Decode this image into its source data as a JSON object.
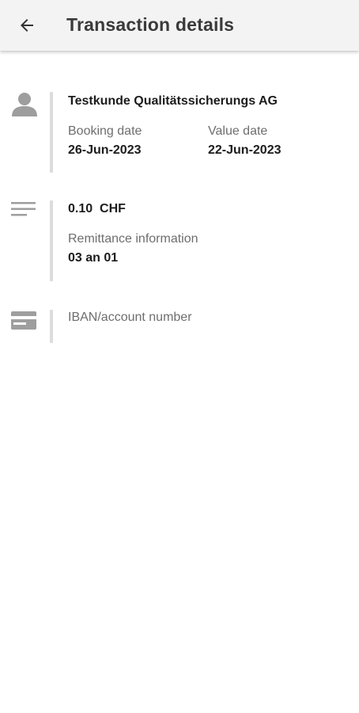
{
  "header": {
    "title": "Transaction details",
    "back_icon": "arrow-left-icon"
  },
  "counterparty": {
    "icon": "person-icon",
    "name": "Testkunde Qualitätssicherungs AG",
    "booking_date_label": "Booking date",
    "booking_date": "26-Jun-2023",
    "value_date_label": "Value date",
    "value_date": "22-Jun-2023"
  },
  "amount": {
    "icon": "notes-lines-icon",
    "value": "0.10  CHF",
    "remittance_label": "Remittance information",
    "remittance_value": "03 an 01"
  },
  "account": {
    "icon": "card-icon",
    "label": "IBAN/account number"
  },
  "colors": {
    "app_bar": "#f3f3f3",
    "icon_gray": "#9e9e9e",
    "divider": "#dcdcdc"
  }
}
